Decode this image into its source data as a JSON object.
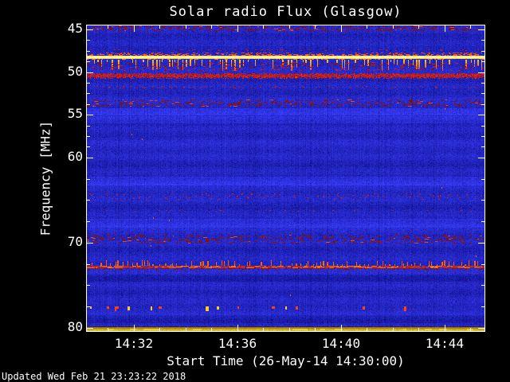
{
  "title": "Solar radio Flux (Glasgow)",
  "footer": {
    "updated": "Updated Wed Feb 21 23:23:22 2018"
  },
  "axes": {
    "x": {
      "label": "Start Time (26-May-14 14:30:00)",
      "start": "14:30:10",
      "end": "14:45:33",
      "ticks": [
        {
          "label": "14:32",
          "minutes": 2
        },
        {
          "label": "14:36",
          "minutes": 6
        },
        {
          "label": "14:40",
          "minutes": 10
        },
        {
          "label": "14:44",
          "minutes": 14
        }
      ],
      "minor_tick_interval_min": 1
    },
    "y": {
      "label": "Frequency [MHz]",
      "range_mhz": [
        44.4,
        80.4
      ],
      "ticks": [
        {
          "label": "45",
          "mhz": 45
        },
        {
          "label": "50",
          "mhz": 50
        },
        {
          "label": "55",
          "mhz": 55
        },
        {
          "label": "60",
          "mhz": 60
        },
        {
          "label": "70",
          "mhz": 70
        },
        {
          "label": "80",
          "mhz": 80
        }
      ],
      "minor_step_low_mhz": 1.25,
      "minor_step_high_mhz": 2.5
    }
  },
  "chart_data": {
    "type": "heatmap",
    "title": "Solar radio Flux (Glasgow)",
    "xlabel": "Start Time (26-May-14 14:30:00)",
    "ylabel": "Frequency [MHz]",
    "x_ticks": [
      "14:32",
      "14:36",
      "14:40",
      "14:44"
    ],
    "x_range": [
      "14:30:10",
      "14:45:33"
    ],
    "y_ticks": [
      45,
      50,
      55,
      60,
      70,
      80
    ],
    "y_range_mhz": [
      44.4,
      80.4
    ],
    "grid": false,
    "legend": "none",
    "observatory": "Glasgow",
    "start_time": "26-May-14 14:30:00",
    "description": "Blue noisy radio spectrogram with persistent horizontal interference bands; no transient solar burst visible",
    "palette": {
      "background": "#1d1dd2",
      "dark_blue": "#000a96",
      "bright_core": "#ffffe0",
      "yellow": "#ffd41e",
      "orange": "#ff7a00",
      "red": "#d42000",
      "dark_red": "#8a1505",
      "gold": "#b89a1e",
      "purple": "#2a1458",
      "frame": "#ffffff"
    },
    "bands": [
      {
        "name": "top-edge-rfi",
        "f_lo": 44.45,
        "f_hi": 45.05,
        "style": "red_dashes",
        "density": 0.5
      },
      {
        "name": "carrier-47.4",
        "f_lo": 47.35,
        "f_hi": 47.45,
        "style": "red_dots",
        "density": 0.3
      },
      {
        "name": "strong-carrier-48.2",
        "f_lo": 47.9,
        "f_hi": 50.0,
        "style": "bright_carrier",
        "density": 0.8
      },
      {
        "name": "band-50.4",
        "f_lo": 50.1,
        "f_hi": 50.7,
        "style": "red_band",
        "density": 0.85
      },
      {
        "name": "carrier-51.7",
        "f_lo": 51.65,
        "f_hi": 51.8,
        "style": "red_dots",
        "density": 0.22
      },
      {
        "name": "band-53.6",
        "f_lo": 53.2,
        "f_hi": 54.0,
        "style": "red_dashes",
        "density": 0.4
      },
      {
        "name": "noise-54.6",
        "f_lo": 54.2,
        "f_hi": 55.0,
        "style": "bright_noise",
        "density": 0
      },
      {
        "name": "noise-55.5",
        "f_lo": 55.2,
        "f_hi": 55.9,
        "style": "bright_noise",
        "density": 0
      },
      {
        "name": "noise-62.7",
        "f_lo": 62.3,
        "f_hi": 63.2,
        "style": "bright_noise",
        "density": 0
      },
      {
        "name": "speckle-64.5",
        "f_lo": 64.2,
        "f_hi": 64.9,
        "style": "red_dots",
        "density": 0.12
      },
      {
        "name": "carrier-66.2",
        "f_lo": 66.15,
        "f_hi": 66.3,
        "style": "red_dots",
        "density": 0.18
      },
      {
        "name": "noise-67.6",
        "f_lo": 67.2,
        "f_hi": 68.1,
        "style": "bright_noise",
        "density": 0
      },
      {
        "name": "band-69.5",
        "f_lo": 69.1,
        "f_hi": 70.0,
        "style": "red_dashes",
        "density": 0.35
      },
      {
        "name": "carrier-73.0",
        "f_lo": 72.4,
        "f_hi": 73.3,
        "style": "flame",
        "density": 0.7
      },
      {
        "name": "dark-74.1",
        "f_lo": 73.7,
        "f_hi": 74.5,
        "style": "dark_band",
        "density": 0
      },
      {
        "name": "sparse-77.8",
        "f_lo": 77.5,
        "f_hi": 78.1,
        "style": "sparse_dashes",
        "density": 0.07
      },
      {
        "name": "dark-78.9",
        "f_lo": 78.5,
        "f_hi": 79.3,
        "style": "dark_band",
        "density": 0
      },
      {
        "name": "gold-80",
        "f_lo": 79.8,
        "f_hi": 80.4,
        "style": "gold_band",
        "density": 0.4
      }
    ]
  }
}
